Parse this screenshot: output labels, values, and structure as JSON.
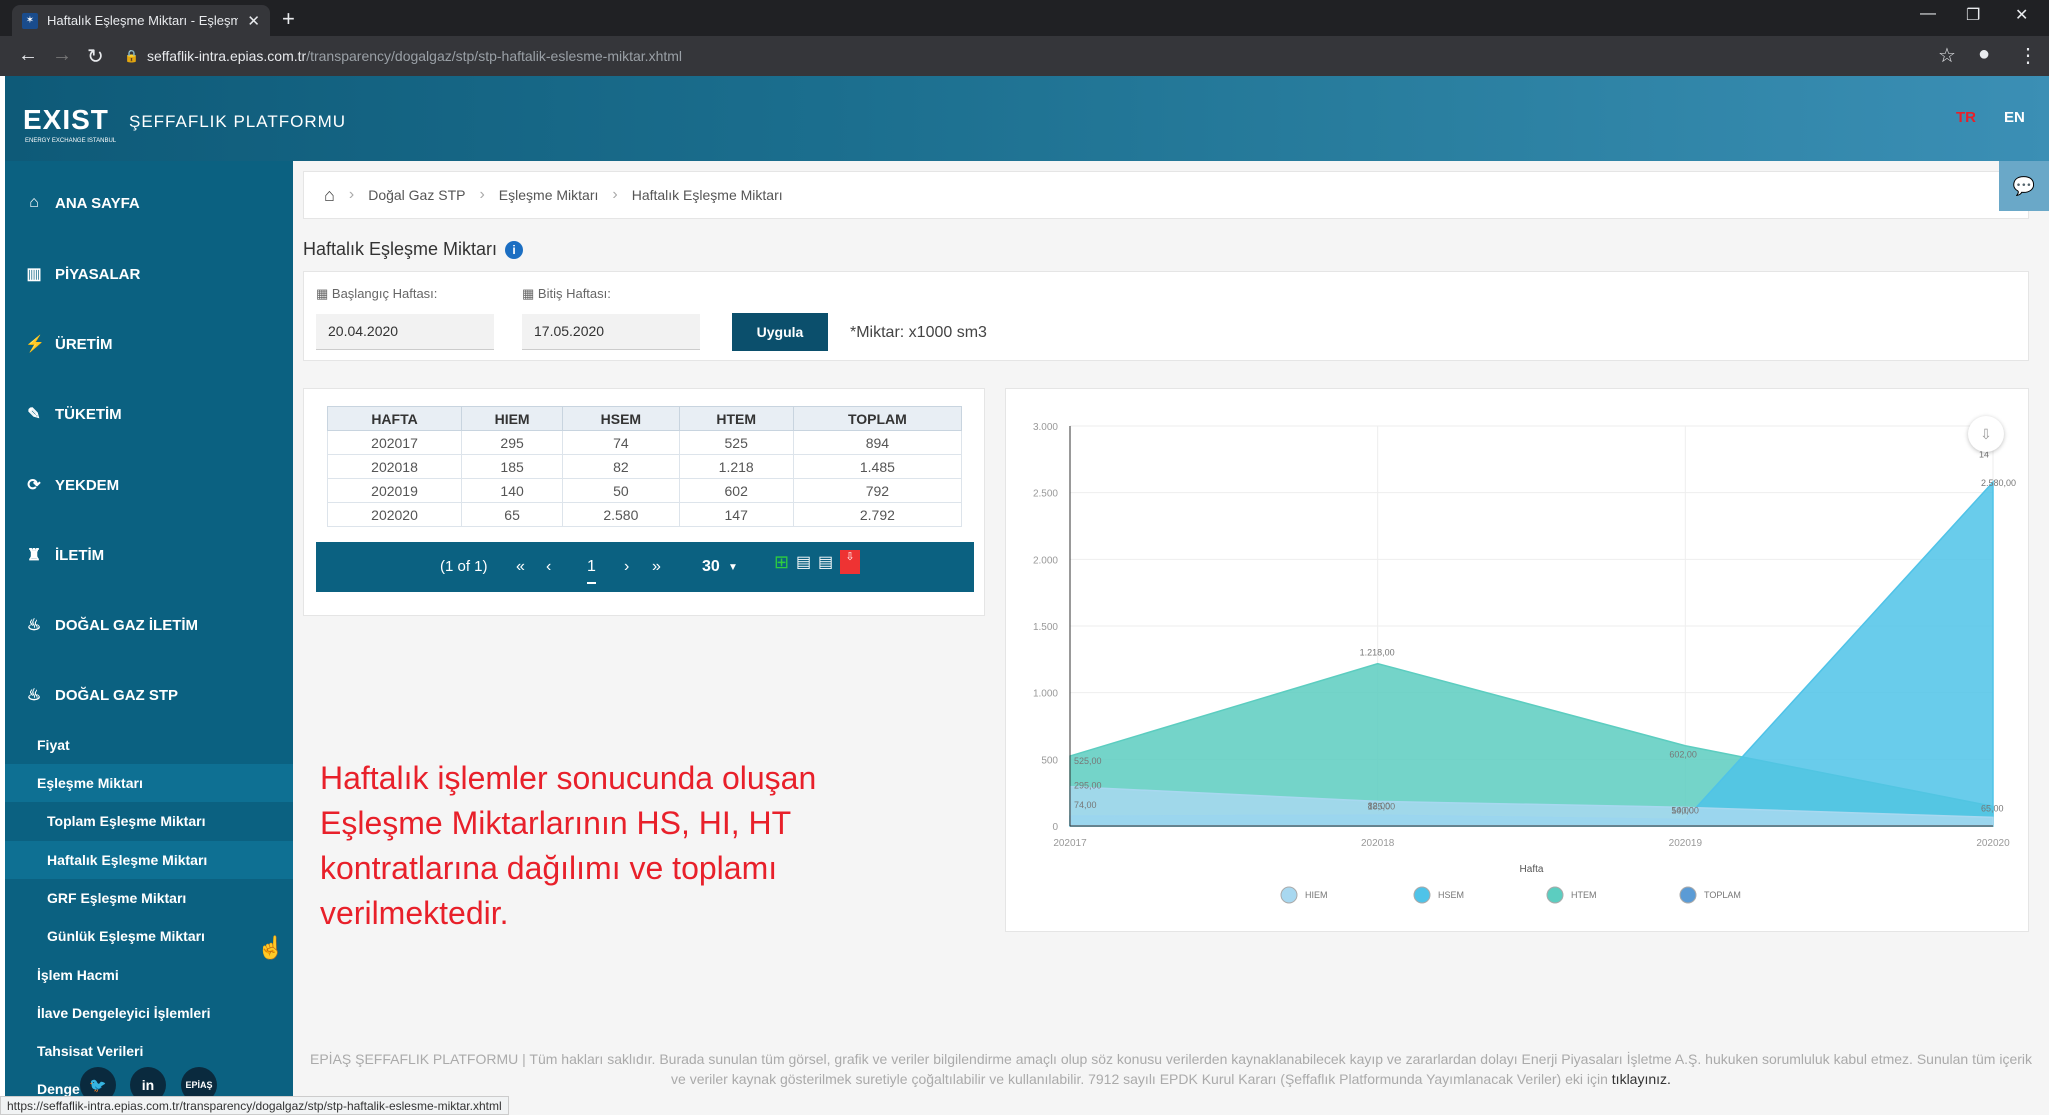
{
  "browser": {
    "tab_title": "Haftalık Eşleşme Miktarı - Eşleşm",
    "url_host": "seffaflik-intra.epias.com.tr",
    "url_path": "/transparency/dogalgaz/stp/stp-haftalik-eslesme-miktar.xhtml",
    "status_url": "https://seffaflik-intra.epias.com.tr/transparency/dogalgaz/stp/stp-haftalik-eslesme-miktar.xhtml"
  },
  "header": {
    "logo": "EXIST",
    "logo_sub": "ENERGY EXCHANGE ISTANBUL",
    "platform_name": "ŞEFFAFLIK PLATFORMU",
    "lang_tr": "TR",
    "lang_en": "EN",
    "lang_tr_color": "#e8202a"
  },
  "sidebar": {
    "items": [
      {
        "label": "ANA SAYFA",
        "icon": "home-icon",
        "glyph": "⌂"
      },
      {
        "label": "PİYASALAR",
        "icon": "bar-chart-icon",
        "glyph": "▥"
      },
      {
        "label": "ÜRETİM",
        "icon": "lightning-icon",
        "glyph": "⚡"
      },
      {
        "label": "TÜKETİM",
        "icon": "plug-icon",
        "glyph": "✎"
      },
      {
        "label": "YEKDEM",
        "icon": "refresh-icon",
        "glyph": "⟳"
      },
      {
        "label": "İLETİM",
        "icon": "tower-icon",
        "glyph": "♜"
      },
      {
        "label": "DOĞAL GAZ İLETİM",
        "icon": "flame-icon",
        "glyph": "♨"
      },
      {
        "label": "DOĞAL GAZ STP",
        "icon": "flame-icon",
        "glyph": "♨"
      }
    ],
    "sub": {
      "fiyat": "Fiyat",
      "eslesme": "Eşleşme Miktarı",
      "toplam": "Toplam Eşleşme Miktarı",
      "haftalik": "Haftalık Eşleşme Miktarı",
      "grf": "GRF Eşleşme Miktarı",
      "gunluk": "Günlük Eşleşme Miktarı",
      "islem": "İşlem Hacmi",
      "ilave": "İlave Dengeleyici İşlemleri",
      "tahsisat": "Tahsisat Verileri",
      "denge": "Denge"
    },
    "social": [
      "twitter-icon",
      "linkedin-icon",
      "epias-icon"
    ],
    "social_glyphs": [
      "🐦",
      "in",
      "EPİAŞ"
    ]
  },
  "breadcrumb": {
    "home_icon": "home-icon",
    "items": [
      "Doğal Gaz STP",
      "Eşleşme Miktarı",
      "Haftalık Eşleşme Miktarı"
    ]
  },
  "page_title": "Haftalık Eşleşme Miktarı",
  "filters": {
    "start_label": "Başlangıç Haftası:",
    "end_label": "Bitiş Haftası:",
    "start_value": "20.04.2020",
    "end_value": "17.05.2020",
    "apply_label": "Uygula",
    "unit_note": "*Miktar: x1000 sm3"
  },
  "table": {
    "headers": [
      "HAFTA",
      "HIEM",
      "HSEM",
      "HTEM",
      "TOPLAM"
    ],
    "rows": [
      [
        "202017",
        "295",
        "74",
        "525",
        "894"
      ],
      [
        "202018",
        "185",
        "82",
        "1.218",
        "1.485"
      ],
      [
        "202019",
        "140",
        "50",
        "602",
        "792"
      ],
      [
        "202020",
        "65",
        "2.580",
        "147",
        "2.792"
      ]
    ],
    "pager": {
      "info": "(1 of 1)",
      "page": "1",
      "page_size": "30",
      "first": "«",
      "prev": "‹",
      "next": "›",
      "last": "»"
    }
  },
  "annotation": "Haftalık işlemler sonucunda oluşan Eşleşme Miktarlarının HS, HI, HT kontratlarına dağılımı ve toplamı verilmektedir.",
  "chart_data": {
    "type": "area",
    "categories": [
      "202017",
      "202018",
      "202019",
      "202020"
    ],
    "series": [
      {
        "name": "HIEM",
        "values": [
          295,
          185,
          140,
          65
        ],
        "color": "#a8d8f0"
      },
      {
        "name": "HSEM",
        "values": [
          74,
          82,
          50,
          2580
        ],
        "color": "#4fc3e8"
      },
      {
        "name": "HTEM",
        "values": [
          525,
          1218,
          602,
          147
        ],
        "color": "#5ccdc0"
      },
      {
        "name": "TOPLAM",
        "values": [
          894,
          1485,
          792,
          2792
        ],
        "color": "#5b9bd5"
      }
    ],
    "xlabel": "Hafta",
    "ylim": [
      0,
      3000
    ],
    "yticks": [
      "0",
      "500",
      "1.000",
      "1.500",
      "2.000",
      "2.500",
      "3.000"
    ],
    "data_labels": [
      "295,00",
      "74,00",
      "1.218,00",
      "82,00",
      "185,00",
      "602,00",
      "50,00",
      "140,00",
      "2.580,00",
      "14",
      "65,00",
      "525,00"
    ],
    "legend_position": "bottom",
    "grid": true
  },
  "footer": {
    "text": "EPİAŞ ŞEFFAFLIK PLATFORMU | Tüm hakları saklıdır. Burada sunulan tüm görsel, grafik ve veriler bilgilendirme amaçlı olup söz konusu verilerden kaynaklanabilecek kayıp ve zararlardan dolayı Enerji Piyasaları İşletme A.Ş. hukuken sorumluluk kabul etmez. Sunulan tüm içerik ve veriler kaynak gösterilmek suretiyle çoğaltılabilir ve kullanılabilir. 7912 sayılı EPDK Kurul Kararı (Şeffaflık Platformunda Yayımlanacak Veriler) eki için",
    "link": "tıklayınız."
  }
}
